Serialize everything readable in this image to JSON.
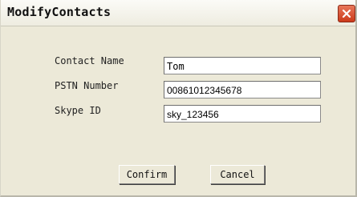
{
  "window": {
    "title": "ModifyContacts"
  },
  "form": {
    "contact_name": {
      "label": "Contact Name",
      "value": "Tom"
    },
    "pstn_number": {
      "label": "PSTN Number",
      "value": "00861012345678"
    },
    "skype_id": {
      "label": "Skype ID",
      "value": "sky_123456"
    }
  },
  "buttons": {
    "confirm": "Confirm",
    "cancel": "Cancel"
  },
  "icons": {
    "close": "close-icon"
  },
  "colors": {
    "close_button": "#cc3a1a",
    "dialog_background": "#ece9d8"
  }
}
